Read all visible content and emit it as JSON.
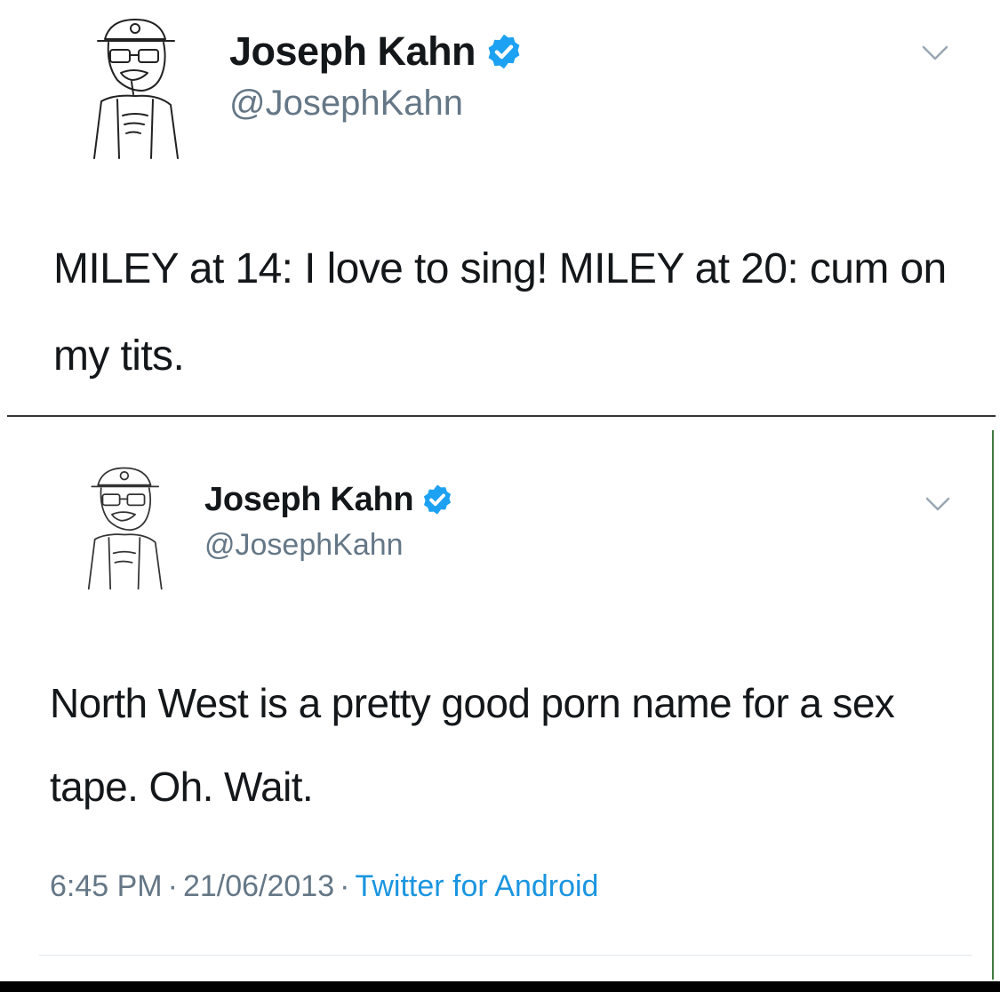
{
  "tweets": [
    {
      "display_name": "Joseph Kahn",
      "handle": "@JosephKahn",
      "avatar_icon": "sketch-portrait-icon",
      "verified_icon": "verified-badge-icon",
      "menu_icon": "chevron-down-icon",
      "text": "MILEY at 14: I love to sing! MILEY at 20: cum on my tits."
    },
    {
      "display_name": "Joseph Kahn",
      "handle": "@JosephKahn",
      "avatar_icon": "sketch-portrait-icon",
      "verified_icon": "verified-badge-icon",
      "menu_icon": "chevron-down-icon",
      "text": "North West is a pretty good porn name for a sex tape. Oh. Wait.",
      "meta": {
        "time": "6:45 PM",
        "separator": "·",
        "date": "21/06/2013",
        "source": "Twitter for Android"
      }
    }
  ],
  "colors": {
    "text_primary": "#14171a",
    "text_secondary": "#657786",
    "link_blue": "#1b95e0",
    "verified_blue": "#1da1f2"
  }
}
